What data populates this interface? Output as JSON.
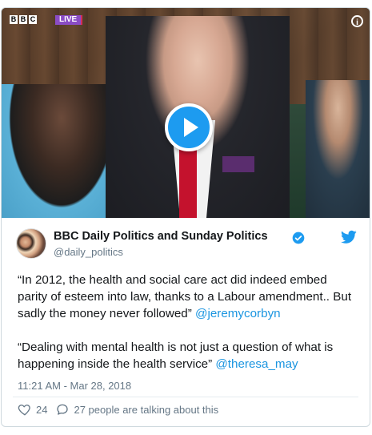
{
  "video": {
    "bbc_letters": [
      "B",
      "B",
      "C"
    ],
    "live_label": "LIVE",
    "info_glyph": "i",
    "play_icon": "play-icon"
  },
  "tweet": {
    "author_name": "BBC Daily Politics and Sunday Politics",
    "handle": "@daily_politics",
    "verified_icon": "verified-badge-icon",
    "brand_icon": "twitter-bird-icon",
    "paragraph1_text": "“In 2012, the health and social care act did indeed embed parity of esteem into law, thanks to a Labour amendment.. But sadly the money never followed” ",
    "paragraph1_mention": "@jeremycorbyn",
    "paragraph2_text": "“Dealing with mental health is not just a question of what is happening inside the health service” ",
    "paragraph2_mention": "@theresa_may",
    "timestamp": "11:21 AM - Mar 28, 2018",
    "likes_count": "24",
    "talking_text": "27 people are talking about this"
  },
  "colors": {
    "accent_blue": "#1d9bf0",
    "mention_blue": "#1b95e0",
    "live_purple": "#8a4cc4",
    "text_gray": "#657786"
  }
}
